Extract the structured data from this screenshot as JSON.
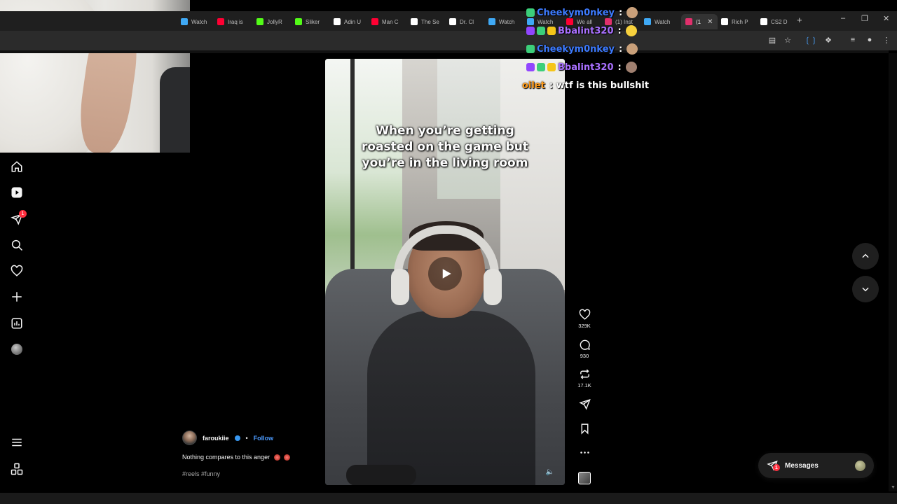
{
  "browser": {
    "tabs": [
      {
        "label": "Watch",
        "icon": "twitch-icon",
        "color": "#3fa9f5"
      },
      {
        "label": "Iraq is",
        "icon": "youtube-icon",
        "color": "#ff0033"
      },
      {
        "label": "JollyR",
        "icon": "kick-icon",
        "color": "#53fc18"
      },
      {
        "label": "Sliker",
        "icon": "kick-icon",
        "color": "#53fc18"
      },
      {
        "label": "Adin U",
        "icon": "x-icon",
        "color": "#ffffff"
      },
      {
        "label": "Man C",
        "icon": "youtube-icon",
        "color": "#ff0033"
      },
      {
        "label": "The Se",
        "icon": "x-icon",
        "color": "#ffffff"
      },
      {
        "label": "Dr. Cl",
        "icon": "x-icon",
        "color": "#ffffff"
      },
      {
        "label": "Watch",
        "icon": "twitch-icon",
        "color": "#3fa9f5"
      },
      {
        "label": "Watch",
        "icon": "twitch-icon",
        "color": "#3fa9f5"
      },
      {
        "label": "We all",
        "icon": "youtube-icon",
        "color": "#ff0033"
      },
      {
        "label": "(1) Inst",
        "icon": "instagram-icon",
        "color": "#e1306c"
      },
      {
        "label": "Watch",
        "icon": "twitch-icon",
        "color": "#3fa9f5"
      },
      {
        "label": "(1",
        "icon": "instagram-icon",
        "color": "#e1306c",
        "active": true
      },
      {
        "label": "Rich P",
        "icon": "x-icon",
        "color": "#ffffff"
      },
      {
        "label": "CS2 D",
        "icon": "tiktok-icon",
        "color": "#ffffff"
      }
    ]
  },
  "chat": {
    "lines": [
      {
        "user": "Cheekym0nkey",
        "user_color": "#3d7bff",
        "message": ":",
        "badges": [
          "#3ccf7a"
        ],
        "emote": "#c9a07a"
      },
      {
        "user": "Bbalint320",
        "user_color": "#a970ff",
        "message": ":",
        "badges": [
          "#9146ff",
          "#3ccf7a",
          "#f5c518"
        ],
        "emote": "#f7d13d"
      },
      {
        "user": "Cheekym0nkey",
        "user_color": "#3d7bff",
        "message": ":",
        "badges": [
          "#3ccf7a"
        ],
        "emote": "#c9a07a"
      },
      {
        "user": "Bbalint320",
        "user_color": "#a970ff",
        "message": ":",
        "badges": [
          "#9146ff",
          "#3ccf7a",
          "#f5c518"
        ],
        "emote": "#a08070"
      },
      {
        "user": "oilet",
        "user_color": "#ff9b1a",
        "message": ": wtf is this bullshit",
        "badges": [],
        "emote": ""
      }
    ]
  },
  "nav": {
    "notifications_badge": "1"
  },
  "reel": {
    "caption": "When you’re getting roasted on the game but you’re in the living room",
    "author": "faroukiie",
    "follow_label": "Follow",
    "separator": "•",
    "description": "Nothing compares to this anger",
    "hashtags": "#reels #funny",
    "likes": "329K",
    "comments": "930",
    "reposts": "17.1K"
  },
  "messages": {
    "label": "Messages",
    "badge": "1"
  },
  "colors": {
    "background": "#000000",
    "accent_link": "#4c9bff",
    "notification_red": "#ff3040"
  }
}
